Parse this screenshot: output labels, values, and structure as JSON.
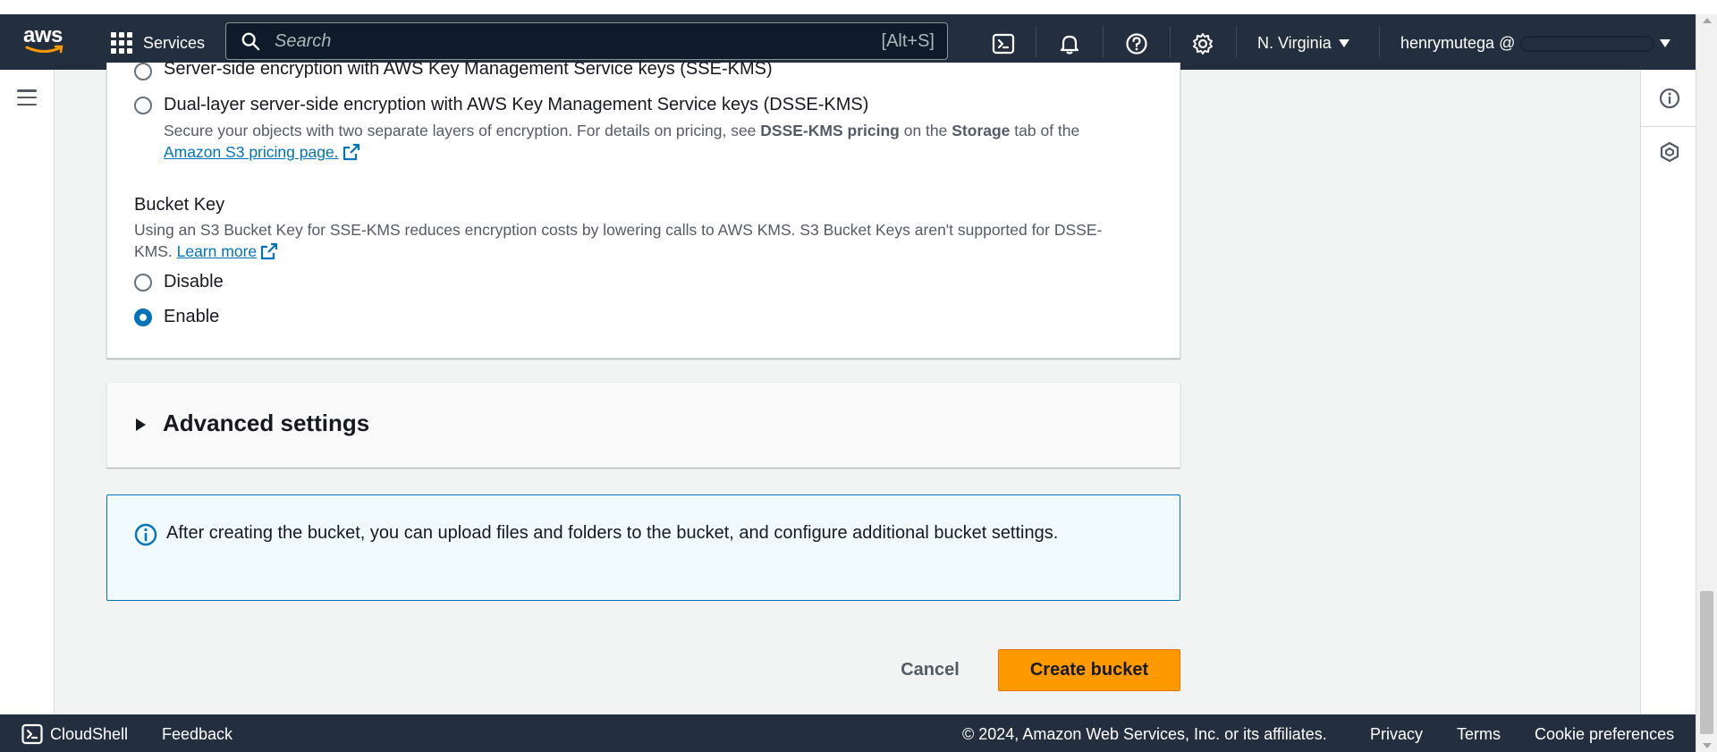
{
  "topnav": {
    "logo_text": "aws",
    "services_label": "Services",
    "search_placeholder": "Search",
    "search_shortcut": "[Alt+S]",
    "region": "N. Virginia",
    "account": "henrymutega @"
  },
  "encryption": {
    "option_sse_kms": "Server-side encryption with AWS Key Management Service keys (SSE-KMS)",
    "option_dsse_kms": "Dual-layer server-side encryption with AWS Key Management Service keys (DSSE-KMS)",
    "dsse_desc_pre": "Secure your objects with two separate layers of encryption. For details on pricing, see ",
    "dsse_desc_bold1": "DSSE-KMS pricing",
    "dsse_desc_mid": " on the ",
    "dsse_desc_bold2": "Storage",
    "dsse_desc_post": " tab of the",
    "pricing_link": "Amazon S3 pricing page."
  },
  "bucket_key": {
    "title": "Bucket Key",
    "desc_line1": "Using an S3 Bucket Key for SSE-KMS reduces encryption costs by lowering calls to AWS KMS. S3 Bucket Keys aren't supported for DSSE-",
    "desc_line2": "KMS. ",
    "learn_more": "Learn more",
    "option_disable": "Disable",
    "option_enable": "Enable",
    "selected": "Enable"
  },
  "advanced": {
    "title": "Advanced settings"
  },
  "info_alert": {
    "message": "After creating the bucket, you can upload files and folders to the bucket, and configure additional bucket settings."
  },
  "actions": {
    "cancel": "Cancel",
    "create": "Create bucket"
  },
  "footer": {
    "cloudshell": "CloudShell",
    "feedback": "Feedback",
    "copyright": "© 2024, Amazon Web Services, Inc. or its affiliates.",
    "privacy": "Privacy",
    "terms": "Terms",
    "cookies": "Cookie preferences"
  },
  "colors": {
    "nav_bg": "#232f3e",
    "accent_blue": "#0073bb",
    "primary_orange": "#ff9900",
    "info_bg": "#f1faff"
  }
}
